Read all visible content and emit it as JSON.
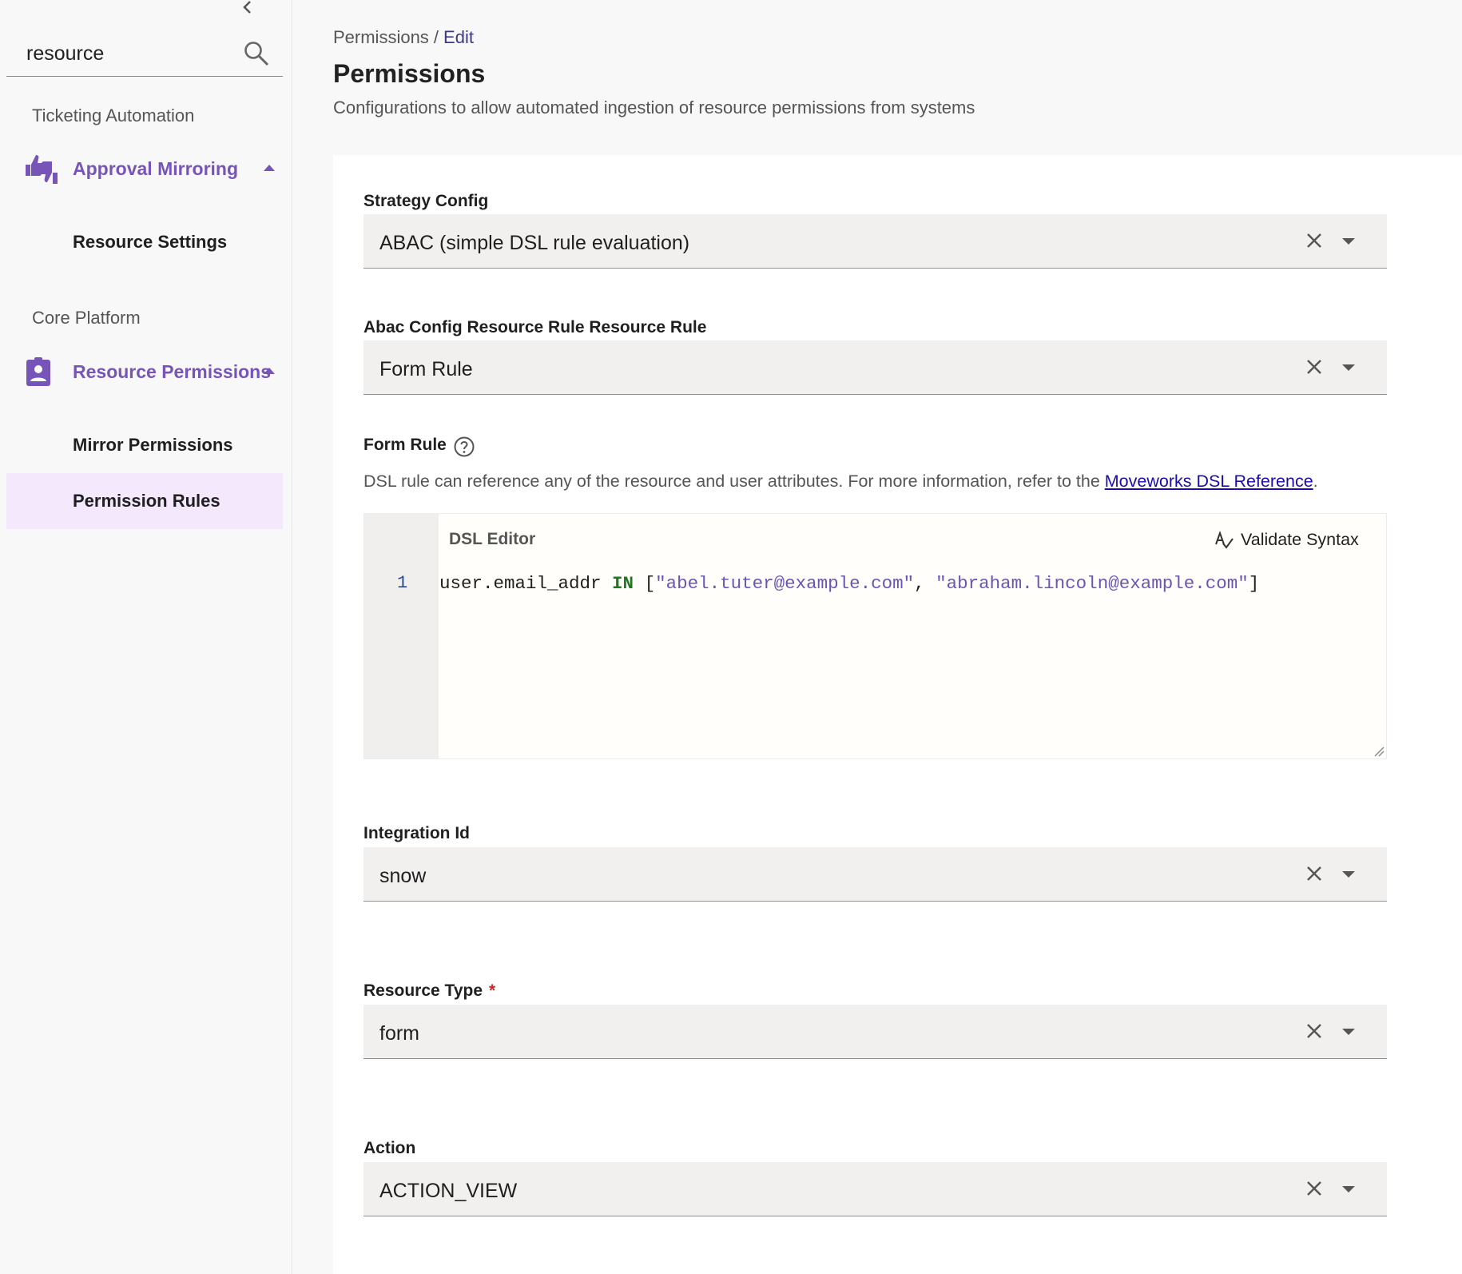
{
  "sidebar": {
    "search": {
      "value": "resource",
      "placeholder": ""
    },
    "sections": [
      {
        "title": "Ticketing Automation",
        "parent": {
          "label": "Approval Mirroring",
          "icon": "thumbs-up-down-icon"
        },
        "children": [
          {
            "label": "Resource Settings"
          }
        ]
      },
      {
        "title": "Core Platform",
        "parent": {
          "label": "Resource Permissions",
          "icon": "assignment-ind-icon"
        },
        "children": [
          {
            "label": "Mirror Permissions"
          },
          {
            "label": "Permission Rules",
            "active": true
          }
        ]
      }
    ]
  },
  "header": {
    "breadcrumb": {
      "root": "Permissions /",
      "current": "Edit"
    },
    "title": "Permissions",
    "description": "Configurations to allow automated ingestion of resource permissions from systems"
  },
  "form": {
    "strategy_config": {
      "label": "Strategy Config",
      "value": "ABAC (simple DSL rule evaluation)"
    },
    "resource_rule": {
      "label": "Abac Config Resource Rule Resource Rule",
      "value": "Form Rule"
    },
    "form_rule": {
      "label": "Form Rule",
      "hint": "DSL rule can reference any of the resource and user attributes. For more information, refer to the",
      "link": "Moveworks DSL Reference",
      "hint_end": ".",
      "editor_title": "DSL Editor",
      "validate_label": "Validate Syntax",
      "line_number": "1",
      "code": {
        "ident": "user.email_addr ",
        "kw": "IN",
        "open": " [",
        "str1": "\"abel.tuter@example.com\"",
        "sep": ", ",
        "str2": "\"abraham.lincoln@example.com\"",
        "close": "]"
      }
    },
    "integration_id": {
      "label": "Integration Id",
      "value": "snow"
    },
    "resource_type": {
      "label": "Resource Type",
      "required_mark": "*",
      "value": "form"
    },
    "action": {
      "label": "Action",
      "value": "ACTION_VIEW"
    }
  },
  "colors": {
    "accent": "#7754b8",
    "active_bg": "#f3e8fc",
    "link": "#1a0dab",
    "required": "#c62828"
  }
}
